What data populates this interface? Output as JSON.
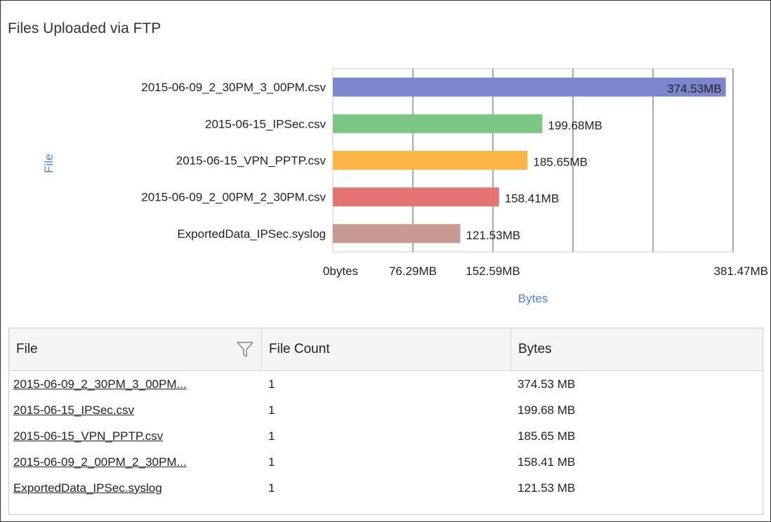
{
  "panel": {
    "title": "Files Uploaded via FTP"
  },
  "chart_data": {
    "type": "bar",
    "orientation": "horizontal",
    "categories": [
      "2015-06-09_2_30PM_3_00PM.csv",
      "2015-06-15_IPSec.csv",
      "2015-06-15_VPN_PPTP.csv",
      "2015-06-09_2_00PM_2_30PM.csv",
      "ExportedData_IPSec.syslog"
    ],
    "values": [
      374.53,
      199.68,
      185.65,
      158.41,
      121.53
    ],
    "value_labels": [
      "374.53MB",
      "199.68MB",
      "185.65MB",
      "158.41MB",
      "121.53MB"
    ],
    "colors": [
      "#7b86cc",
      "#7dc785",
      "#fdb545",
      "#e57373",
      "#c89a93"
    ],
    "xlabel": "Bytes",
    "ylabel": "File",
    "xlim": [
      0,
      381.47
    ],
    "x_ticks": [
      0,
      76.29,
      152.59,
      381.47
    ],
    "x_tick_labels": [
      "0bytes",
      "76.29MB",
      "152.59MB",
      "381.47MB"
    ],
    "grid": true,
    "legend": "none"
  },
  "table": {
    "columns": [
      "File",
      "File Count",
      "Bytes"
    ],
    "rows": [
      {
        "file": "2015-06-09_2_30PM_3_00PM...",
        "count": "1",
        "bytes": "374.53 MB"
      },
      {
        "file": "2015-06-15_IPSec.csv",
        "count": "1",
        "bytes": "199.68 MB"
      },
      {
        "file": "2015-06-15_VPN_PPTP.csv",
        "count": "1",
        "bytes": "185.65 MB"
      },
      {
        "file": "2015-06-09_2_00PM_2_30PM...",
        "count": "1",
        "bytes": "158.41 MB"
      },
      {
        "file": "ExportedData_IPSec.syslog",
        "count": "1",
        "bytes": "121.53 MB"
      }
    ],
    "filter_icon": "filter-funnel-icon"
  }
}
